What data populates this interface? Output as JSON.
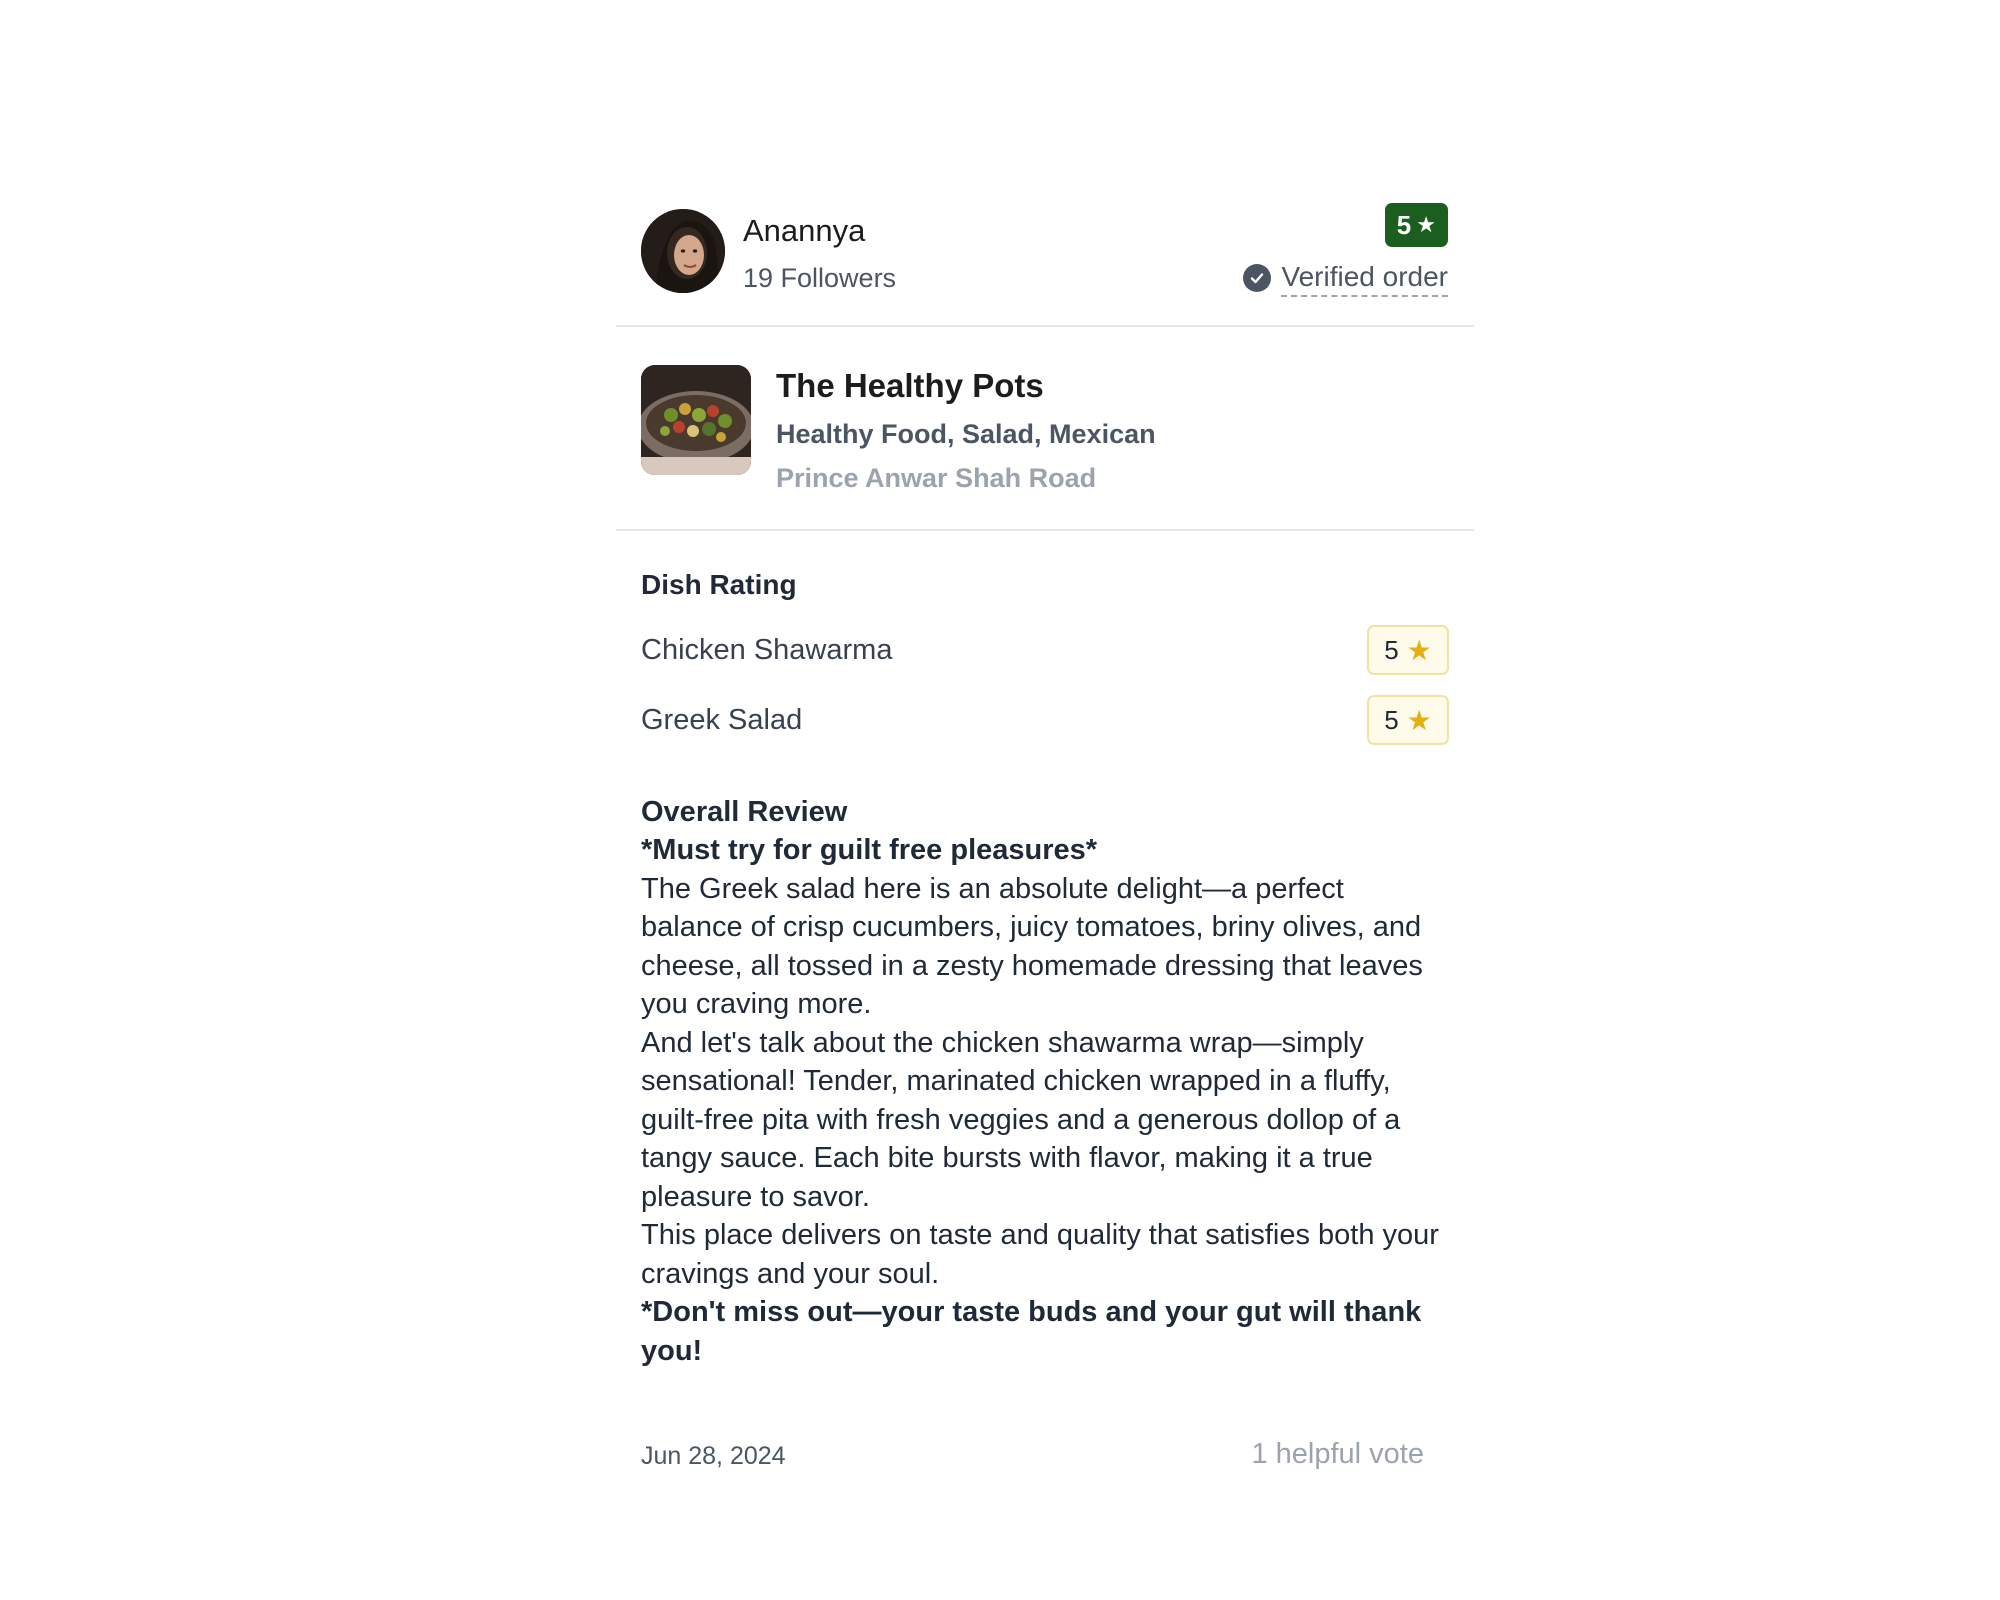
{
  "reviewer": {
    "name": "Anannya",
    "followers": "19 Followers",
    "rating": "5",
    "verified_label": "Verified order"
  },
  "restaurant": {
    "name": "The Healthy Pots",
    "cuisines": "Healthy Food, Salad, Mexican",
    "location": "Prince Anwar Shah Road"
  },
  "dish_rating": {
    "title": "Dish Rating",
    "dishes": [
      {
        "name": "Chicken Shawarma",
        "rating": "5"
      },
      {
        "name": "Greek Salad",
        "rating": "5"
      }
    ]
  },
  "review": {
    "title": "Overall Review",
    "headline": "*Must try for guilt free pleasures*",
    "paragraph_1": "The Greek salad here is an absolute delight—a perfect balance of crisp cucumbers, juicy tomatoes, briny olives, and cheese, all tossed in a zesty homemade dressing that leaves you craving more.",
    "paragraph_2": "And let's talk about the chicken shawarma wrap—simply sensational! Tender, marinated chicken wrapped in a fluffy, guilt-free pita with fresh veggies and a generous dollop of a tangy sauce. Each bite bursts with flavor, making it a true pleasure to savor.",
    "paragraph_3": "This place delivers on taste and quality that satisfies both your cravings and your soul.",
    "closing": "*Don't miss out—your taste buds and your gut will thank you!"
  },
  "footer": {
    "date": "Jun 28, 2024",
    "helpful": "1 helpful vote"
  },
  "colors": {
    "rating_green": "#1b5e20",
    "star_gold": "#e3b012",
    "badge_bg": "#fffbea",
    "badge_border": "#f1e3a3",
    "muted_text": "#4b5563",
    "light_text": "#9ca3af"
  },
  "icons": {
    "rating_star": "star-icon",
    "verified": "check-circle-icon"
  }
}
